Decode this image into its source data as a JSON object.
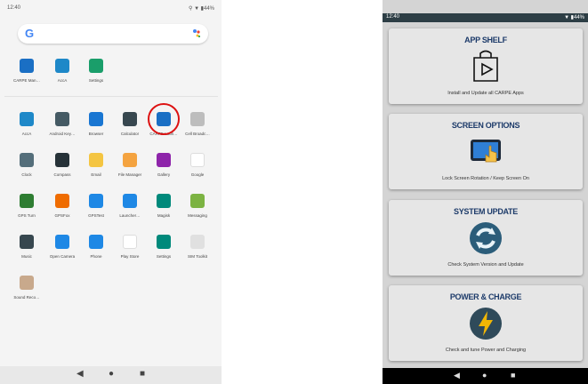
{
  "left_phone": {
    "status": {
      "time": "12:40",
      "right": "⚲ ▼ ▮44%"
    },
    "search": {
      "logo": "G"
    },
    "apps": [
      {
        "label": "CARPE Man…",
        "icon": "carpe-icon",
        "color": "#1a6fc4"
      },
      {
        "label": "AccA",
        "icon": "acca-icon",
        "color": "#1e88c8"
      },
      {
        "label": "Settings",
        "icon": "settings-icon",
        "color": "#1a9e6a"
      },
      {
        "label": "AccA",
        "icon": "acca-icon",
        "color": "#1e88c8"
      },
      {
        "label": "Android Key…",
        "icon": "keyboard-icon",
        "color": "#455a64"
      },
      {
        "label": "Browser",
        "icon": "browser-icon",
        "color": "#1976d2"
      },
      {
        "label": "Calculator",
        "icon": "calculator-icon",
        "color": "#37474f"
      },
      {
        "label": "CARPE Laun…",
        "icon": "carpe-icon",
        "color": "#1a6fc4"
      },
      {
        "label": "Cell Broadc…",
        "icon": "cell-broadcast-icon",
        "color": "#bdbdbd"
      },
      {
        "label": "Clock",
        "icon": "clock-icon",
        "color": "#546e7a"
      },
      {
        "label": "Compass",
        "icon": "compass-icon",
        "color": "#263238"
      },
      {
        "label": "Email",
        "icon": "email-icon",
        "color": "#f4c542"
      },
      {
        "label": "File Manager",
        "icon": "file-manager-icon",
        "color": "#f4a340"
      },
      {
        "label": "Gallery",
        "icon": "gallery-icon",
        "color": "#8e24aa"
      },
      {
        "label": "Google",
        "icon": "google-icon",
        "color": "#ffffff"
      },
      {
        "label": "GPS Turn",
        "icon": "gps-turn-icon",
        "color": "#2e7d32"
      },
      {
        "label": "GPSFox",
        "icon": "gpsfox-icon",
        "color": "#ef6c00"
      },
      {
        "label": "GPSTest",
        "icon": "gpstest-icon",
        "color": "#1e88e5"
      },
      {
        "label": "Launcher…",
        "icon": "launcher-icon",
        "color": "#1e88e5"
      },
      {
        "label": "Magisk",
        "icon": "magisk-icon",
        "color": "#00897b"
      },
      {
        "label": "Messaging",
        "icon": "messaging-icon",
        "color": "#7cb342"
      },
      {
        "label": "Music",
        "icon": "music-icon",
        "color": "#37474f"
      },
      {
        "label": "Open Camera",
        "icon": "camera-icon",
        "color": "#1e88e5"
      },
      {
        "label": "Phone",
        "icon": "phone-icon",
        "color": "#1e88e5"
      },
      {
        "label": "Play Store",
        "icon": "play-store-icon",
        "color": "#ffffff"
      },
      {
        "label": "Settings",
        "icon": "settings-icon",
        "color": "#00897b"
      },
      {
        "label": "SIM Toolkit",
        "icon": "sim-toolkit-icon",
        "color": "#e0e0e0"
      },
      {
        "label": "Sound Reco…",
        "icon": "sound-recorder-icon",
        "color": "#c8a98c"
      }
    ],
    "nav": {
      "back": "◀",
      "home": "●",
      "recents": "■"
    }
  },
  "right_phone": {
    "status": {
      "time": "12:40",
      "right": "▼ ▮44%"
    },
    "panels": [
      {
        "title": "APP SHELF",
        "desc": "Install and Update all CARPE Apps",
        "icon": "app-shelf-icon"
      },
      {
        "title": "SCREEN OPTIONS",
        "desc": "Lock Screen Rotation / Keep Screen On",
        "icon": "screen-options-icon"
      },
      {
        "title": "SYSTEM UPDATE",
        "desc": "Check System Version and Update",
        "icon": "system-update-icon"
      },
      {
        "title": "POWER & CHARGE",
        "desc": "Check and tune Power and Charging",
        "icon": "power-charge-icon"
      }
    ],
    "nav": {
      "back": "◀",
      "home": "●",
      "recents": "■"
    }
  }
}
